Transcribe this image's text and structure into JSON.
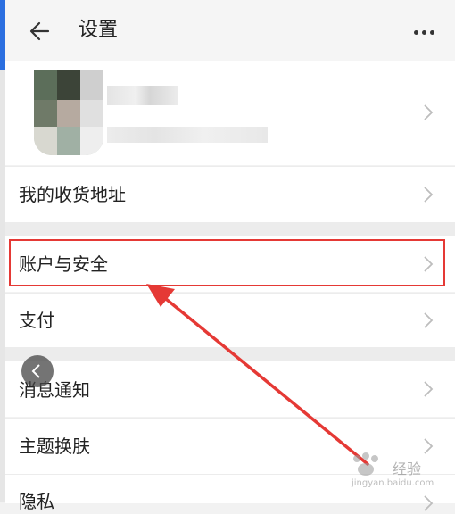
{
  "header": {
    "title": "设置",
    "back_icon": "arrow-left-icon",
    "more_icon": "more-dots-icon"
  },
  "profile": {
    "avatar": "blurred-avatar",
    "name_redacted": true
  },
  "menu": {
    "address": "我的收货地址",
    "account_security": "账户与安全",
    "payment": "支付",
    "notifications": "消息通知",
    "theme": "主题换肤",
    "privacy": "隐私"
  },
  "annotation": {
    "highlight_color": "#e53935",
    "highlighted_item": "账户与安全"
  },
  "watermark": {
    "text": "经验",
    "url": "jingyan.baidu.com"
  }
}
